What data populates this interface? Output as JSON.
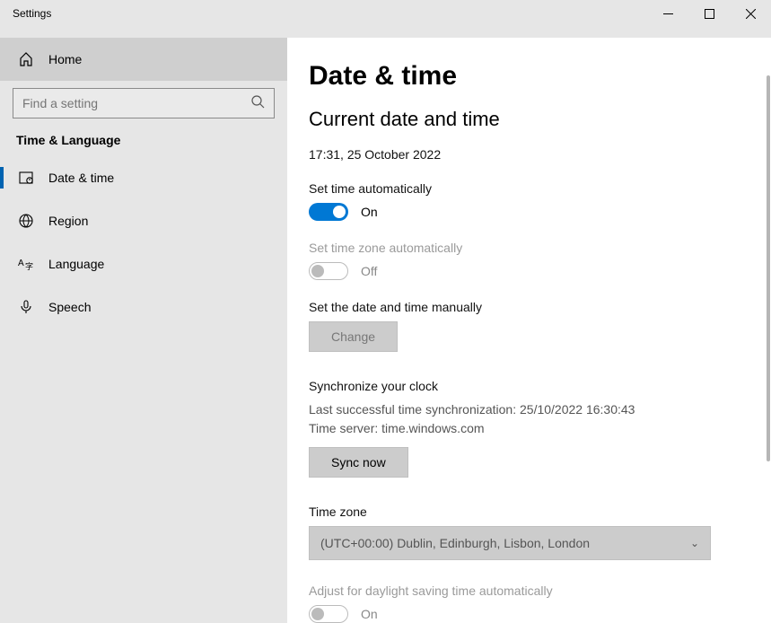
{
  "titlebar": {
    "title": "Settings"
  },
  "sidebar": {
    "home_label": "Home",
    "search_placeholder": "Find a setting",
    "section_label": "Time & Language",
    "items": [
      {
        "label": "Date & time"
      },
      {
        "label": "Region"
      },
      {
        "label": "Language"
      },
      {
        "label": "Speech"
      }
    ]
  },
  "main": {
    "heading": "Date & time",
    "subheading": "Current date and time",
    "current_datetime": "17:31, 25 October 2022",
    "set_time_auto": {
      "label": "Set time automatically",
      "value_label": "On"
    },
    "set_tz_auto": {
      "label": "Set time zone automatically",
      "value_label": "Off"
    },
    "set_manual": {
      "label": "Set the date and time manually",
      "button_label": "Change"
    },
    "sync": {
      "heading": "Synchronize your clock",
      "last_sync": "Last successful time synchronization: 25/10/2022 16:30:43",
      "server": "Time server: time.windows.com",
      "button_label": "Sync now"
    },
    "timezone": {
      "label": "Time zone",
      "selected": "(UTC+00:00) Dublin, Edinburgh, Lisbon, London"
    },
    "dst": {
      "label": "Adjust for daylight saving time automatically",
      "value_label": "On"
    }
  }
}
